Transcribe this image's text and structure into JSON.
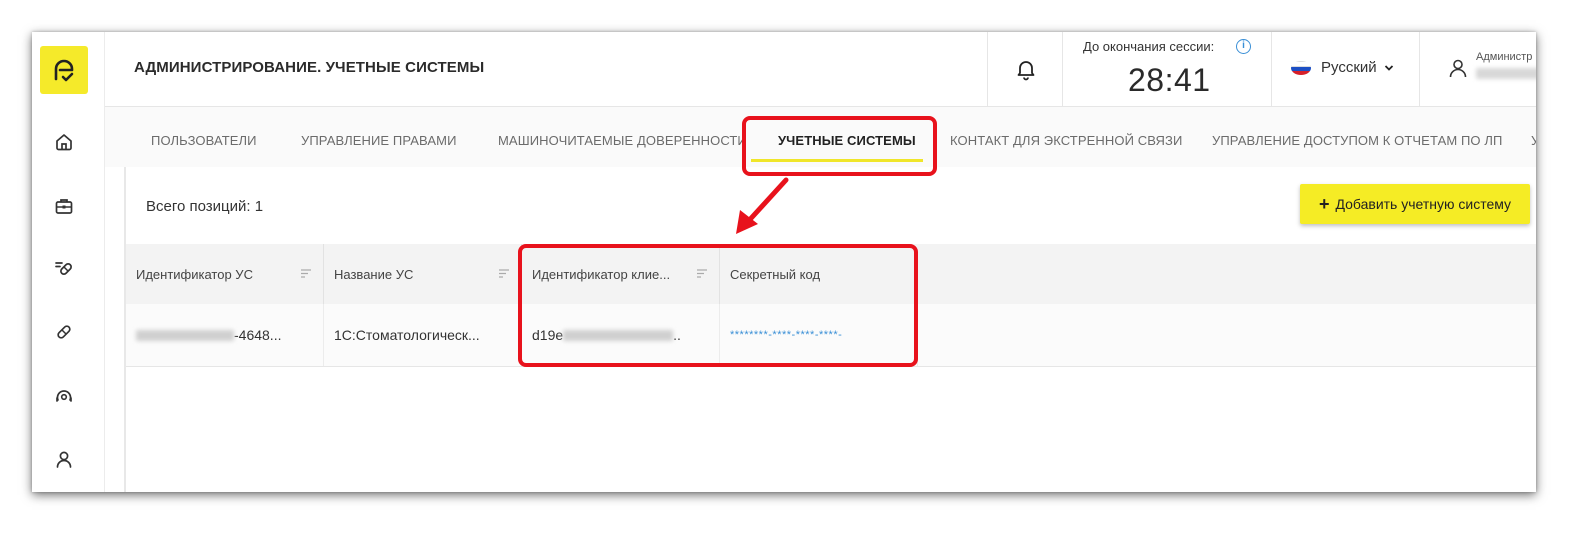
{
  "app": {
    "page_title": "АДМИНИСТРИРОВАНИЕ. УЧЕТНЫЕ СИСТЕМЫ"
  },
  "header": {
    "session_label": "До окончания сессии:",
    "session_timer": "28:41",
    "language": "Русский",
    "user_role": "Администр"
  },
  "tabs": [
    {
      "label": "ПОЛЬЗОВАТЕЛИ"
    },
    {
      "label": "УПРАВЛЕНИЕ ПРАВАМИ"
    },
    {
      "label": "МАШИНОЧИТАЕМЫЕ ДОВЕРЕННОСТИ"
    },
    {
      "label": "УЧЕТНЫЕ СИСТЕМЫ",
      "active": true
    },
    {
      "label": "КОНТАКТ ДЛЯ ЭКСТРЕННОЙ СВЯЗИ"
    },
    {
      "label": "УПРАВЛЕНИЕ ДОСТУПОМ К ОТЧЕТАМ ПО ЛП"
    },
    {
      "label": "У"
    }
  ],
  "content": {
    "count_label": "Всего позиций: 1",
    "add_button": "Добавить учетную систему"
  },
  "table": {
    "columns": [
      "Идентификатор УС",
      "Название УС",
      "Идентификатор клие...",
      "Секретный код"
    ],
    "rows": [
      {
        "id_suffix": "-4648...",
        "name": "1С:Стоматологическ...",
        "client_id_prefix": "d19e",
        "client_id_suffix": "..",
        "secret": "********-****-****-****-"
      }
    ]
  },
  "colors": {
    "accent": "#f5ec25",
    "annotation": "#e8121c",
    "link": "#3a8fd6"
  },
  "icons": [
    "logo-icon",
    "home-icon",
    "briefcase-icon",
    "pills-icon",
    "capsule-icon",
    "support-icon",
    "user-icon",
    "bell-icon",
    "info-icon",
    "chevron-down-icon",
    "sort-icon",
    "plus-icon"
  ]
}
